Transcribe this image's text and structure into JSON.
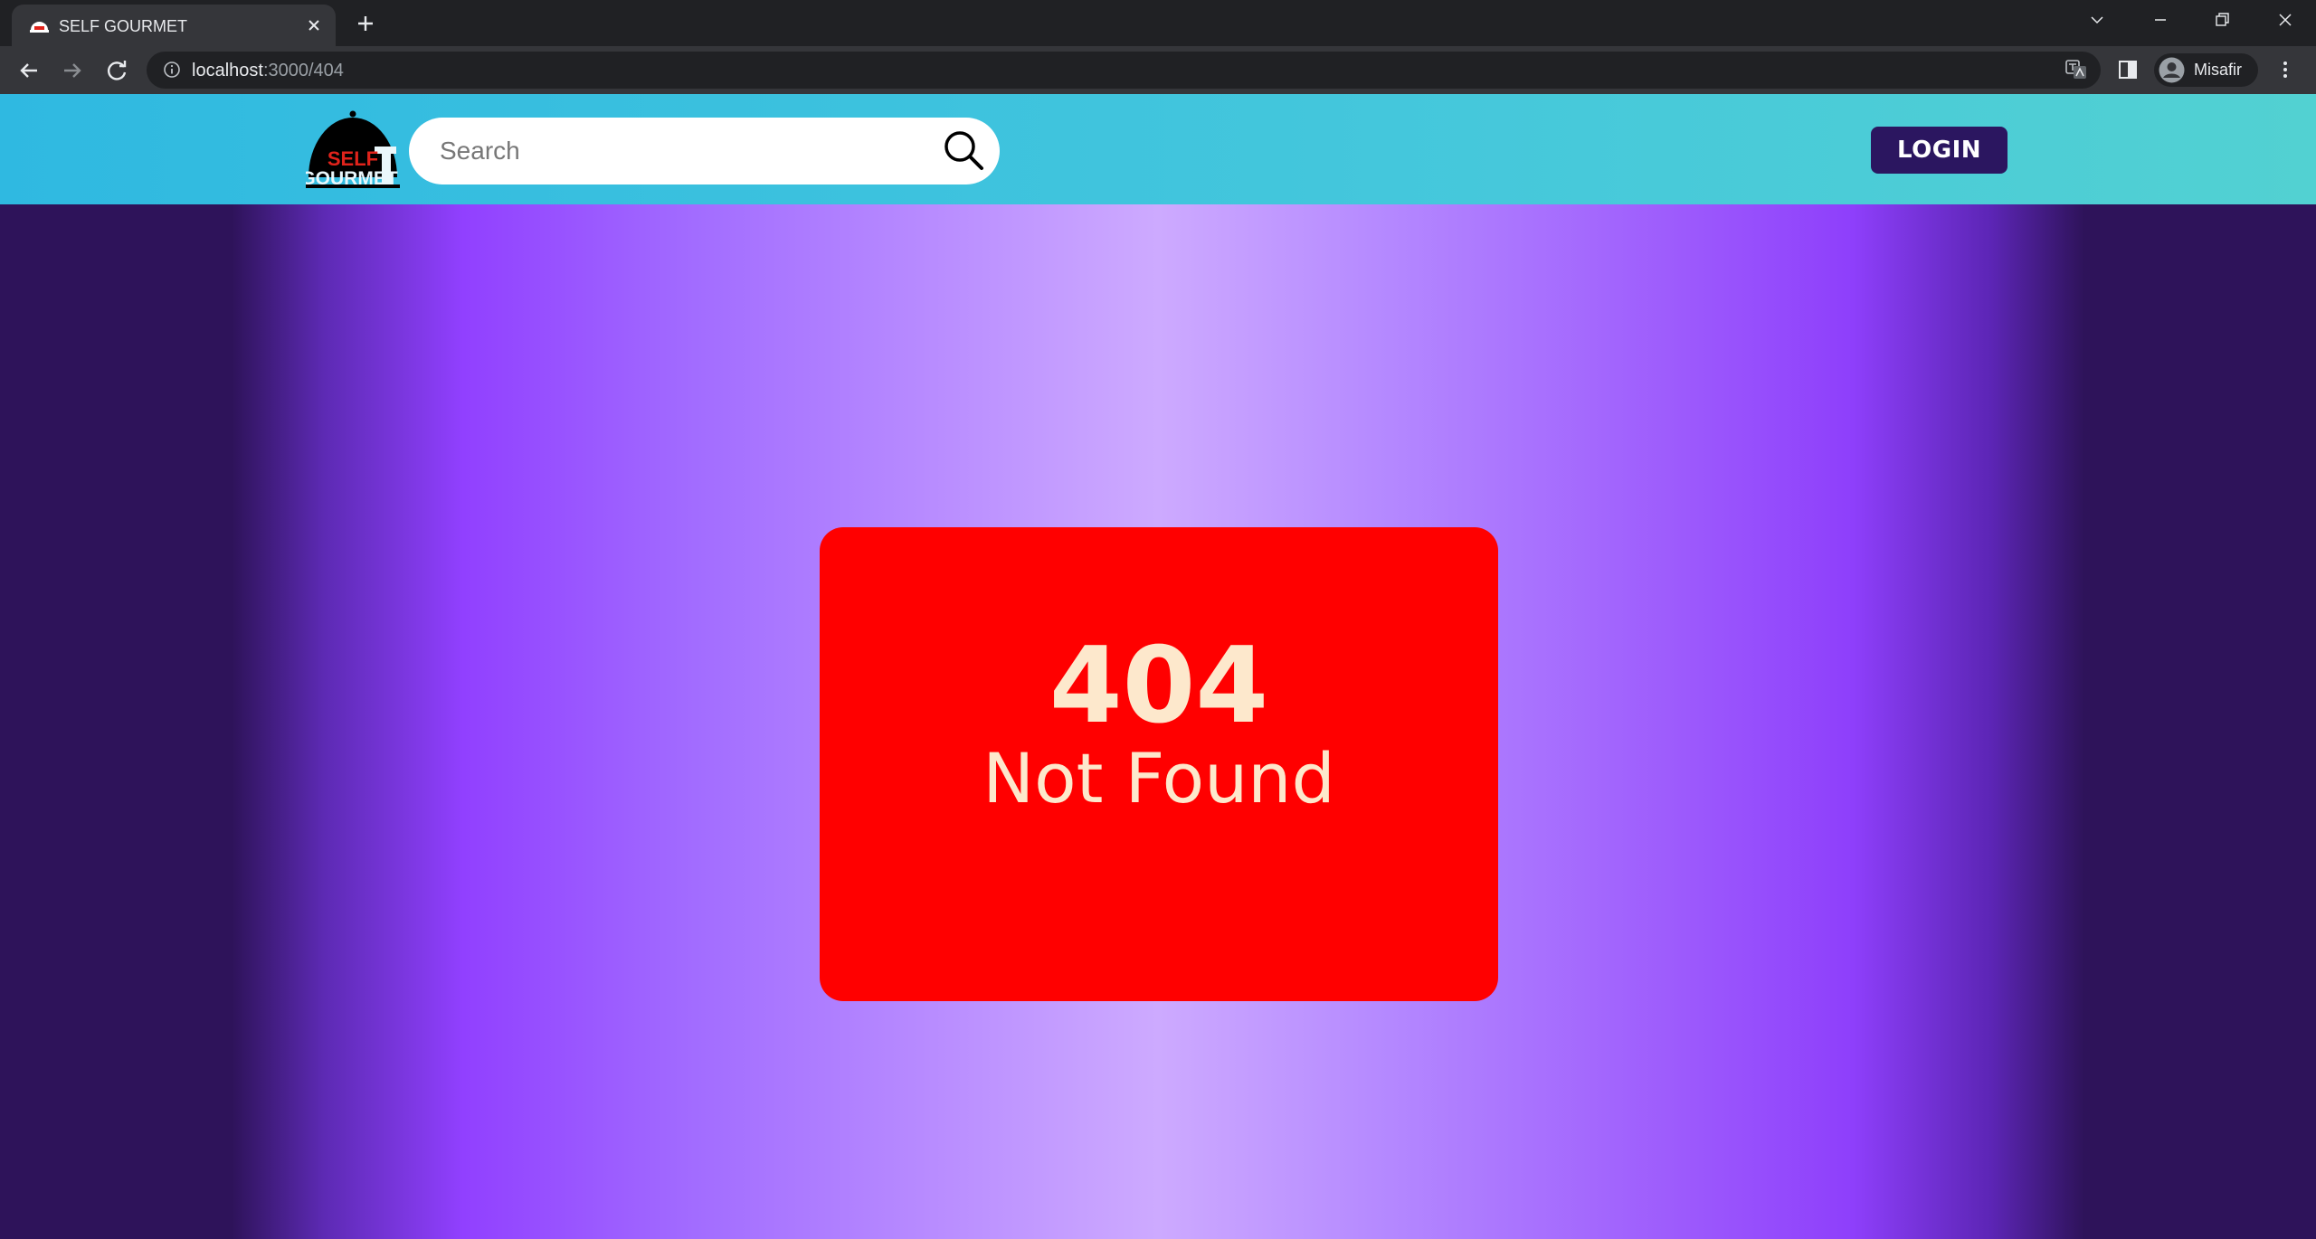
{
  "browser": {
    "tab_title": "SELF GOURMET",
    "url_host": "localhost",
    "url_path": ":3000/404",
    "profile_name": "Misafir"
  },
  "site": {
    "logo": {
      "text_top": "SELF",
      "text_bottom": "GOURMET"
    },
    "search": {
      "placeholder": "Search"
    },
    "login_label": "LOGIN"
  },
  "error": {
    "code": "404",
    "message": "Not Found"
  },
  "colors": {
    "header_gradient_start": "#2fb9e1",
    "header_gradient_end": "#52d1d2",
    "login_button": "#2b1660",
    "card_background": "#ff0000",
    "card_text": "#fde8cc",
    "page_dark": "#2e135a",
    "page_purple": "#9140ff",
    "page_light": "#cdaaff"
  },
  "icons": [
    "app-favicon-icon",
    "close-icon",
    "plus-icon",
    "chevron-down-icon",
    "minimize-icon",
    "restore-icon",
    "window-close-icon",
    "back-arrow-icon",
    "forward-arrow-icon",
    "reload-icon",
    "info-icon",
    "translate-icon",
    "side-panel-icon",
    "avatar-icon",
    "kebab-menu-icon",
    "search-icon"
  ]
}
